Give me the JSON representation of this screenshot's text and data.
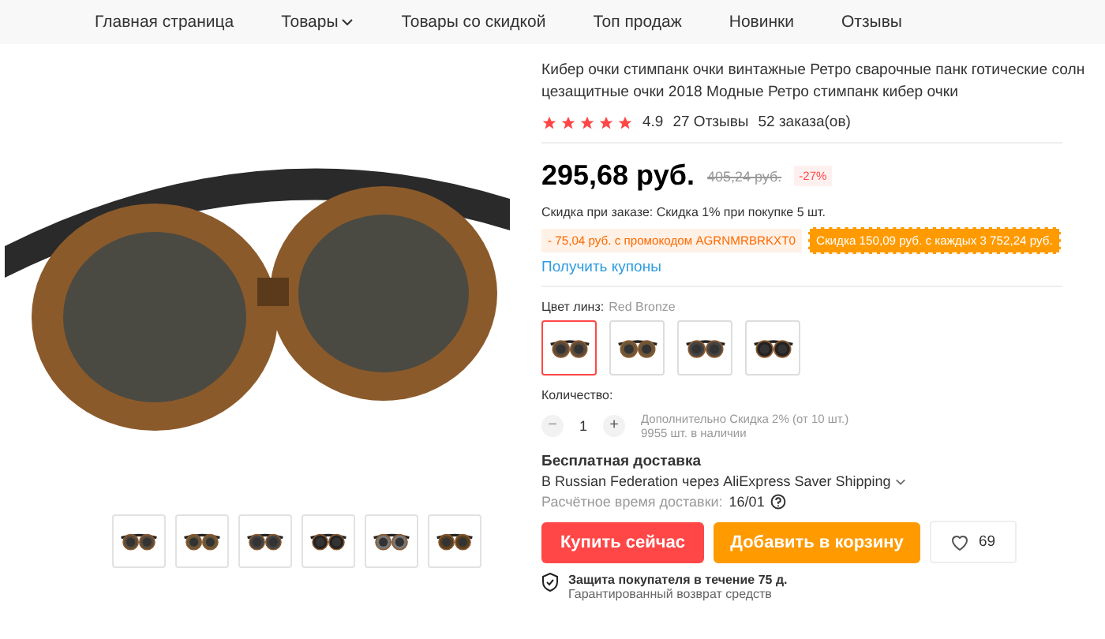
{
  "nav": [
    {
      "label": "Главная страница",
      "has_menu": false
    },
    {
      "label": "Товары",
      "has_menu": true
    },
    {
      "label": "Товары со скидкой",
      "has_menu": false
    },
    {
      "label": "Топ продаж",
      "has_menu": false
    },
    {
      "label": "Новинки",
      "has_menu": false
    },
    {
      "label": "Отзывы",
      "has_menu": false
    }
  ],
  "gallery": {
    "thumbnails": [
      {
        "selected": false
      },
      {
        "selected": false
      },
      {
        "selected": false
      },
      {
        "selected": false
      },
      {
        "selected": false
      },
      {
        "selected": false
      }
    ]
  },
  "product": {
    "title": "Кибер очки стимпанк очки винтажные Ретро сварочные панк готические солнцезащитные очки 2018 Модные Ретро стимпанк кибер очки",
    "stars": 5,
    "rating": "4.9",
    "reviews": "27 Отзывы",
    "orders": "52 заказа(ов)",
    "price": "295,68 руб.",
    "old_price": "405,24 руб.",
    "discount": "-27%",
    "bulk_discount": "Скидка при заказе: Скидка 1% при покупке 5 шт.",
    "coupons": [
      "- 75,04 руб. с промокодом AGRNMRBRKXT0",
      "Скидка 150,09 руб. с каждых 3 752,24 руб."
    ],
    "get_coupons": "Получить купоны",
    "color_label": "Цвет линз:",
    "color_value": "Red Bronze",
    "colors": [
      {
        "selected": true
      },
      {
        "selected": false
      },
      {
        "selected": false
      },
      {
        "selected": false
      }
    ],
    "quantity_label": "Количество:",
    "quantity": "1",
    "minus": "−",
    "plus": "+",
    "extra_discount": "Дополнительно Скидка 2% (от 10 шт.)",
    "stock": "9955 шт. в наличии",
    "shipping_title": "Бесплатная доставка",
    "shipping_route": "В Russian Federation через AliExpress Saver Shipping",
    "delivery_label": "Расчётное время доставки:",
    "delivery_date": "16/01",
    "buy": "Купить сейчас",
    "cart": "Добавить в корзину",
    "wishlist": "69",
    "protection_title": "Защита покупателя в течение 75 д.",
    "protection_text": "Гарантированный возврат средств"
  }
}
